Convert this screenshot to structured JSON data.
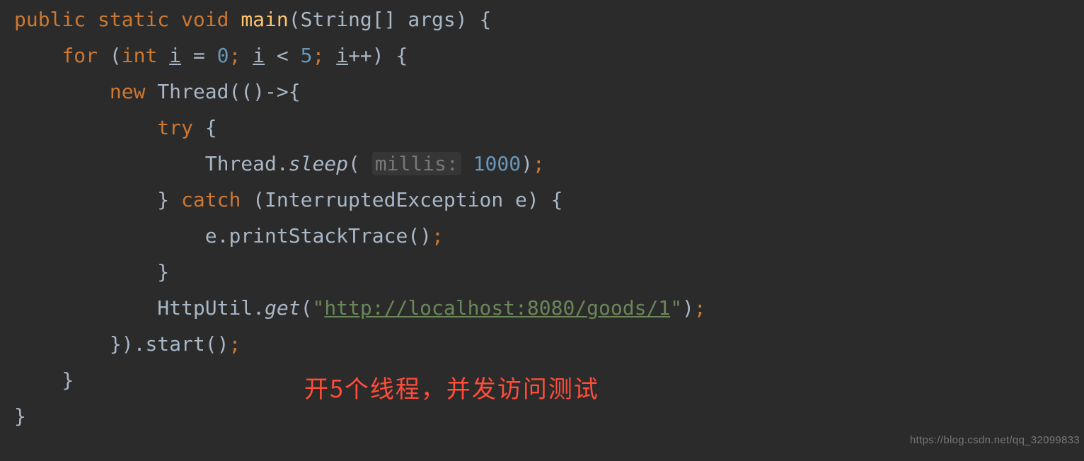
{
  "code": {
    "kw_public": "public",
    "kw_static": "static",
    "kw_void": "void",
    "fn_main": "main",
    "param_type": "String[]",
    "param_name": "args",
    "kw_for": "for",
    "kw_int": "int",
    "var_i": "i",
    "eq": "=",
    "zero": "0",
    "lt": "<",
    "five": "5",
    "inc": "++",
    "kw_new": "new",
    "thread_ctor": "Thread",
    "kw_try": "try",
    "cls_thread": "Thread",
    "m_sleep": "sleep",
    "hint_millis": "millis:",
    "sleep_val": "1000",
    "kw_catch": "catch",
    "exc_type": "InterruptedException",
    "exc_var": "e",
    "m_print": "printStackTrace",
    "cls_httputil": "HttpUtil",
    "m_get": "get",
    "url_str": "http://localhost:8080/goods/1",
    "m_start": "start",
    "brace_open": "{",
    "brace_close": "}",
    "paren_open": "(",
    "paren_close": ")",
    "semi": ";",
    "comma": ",",
    "dot": ".",
    "arrow": "->",
    "quote": "\""
  },
  "annotation": "开5个线程，并发访问测试",
  "watermark": "https://blog.csdn.net/qq_32099833"
}
